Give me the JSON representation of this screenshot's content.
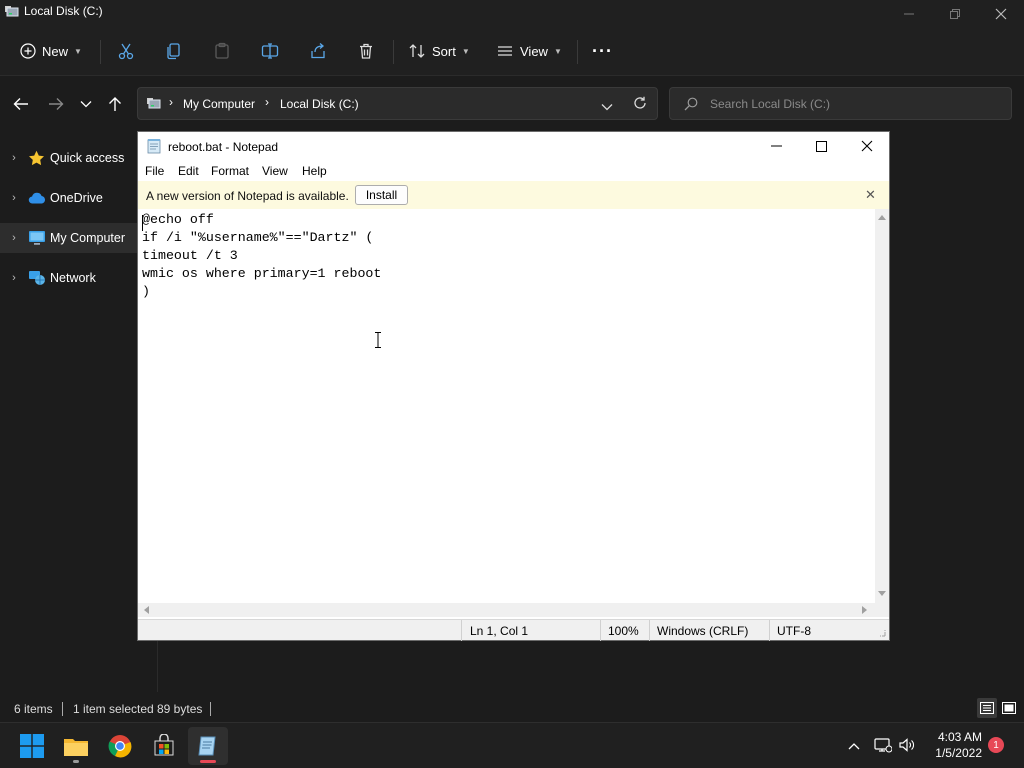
{
  "explorer": {
    "title": "Local Disk (C:)",
    "toolbar": {
      "new_label": "New",
      "sort_label": "Sort",
      "view_label": "View",
      "more_label": "···"
    },
    "breadcrumb": [
      "My Computer",
      "Local Disk (C:)"
    ],
    "search": {
      "placeholder": "Search Local Disk (C:)"
    },
    "sidebar": {
      "items": [
        {
          "label": "Quick access",
          "icon": "star-icon"
        },
        {
          "label": "OneDrive",
          "icon": "cloud-icon"
        },
        {
          "label": "My Computer",
          "icon": "computer-icon",
          "selected": true
        },
        {
          "label": "Network",
          "icon": "network-icon"
        }
      ]
    },
    "status": {
      "items_count": "6 items",
      "selection": "1 item selected",
      "size": "89 bytes"
    }
  },
  "notepad": {
    "title": "reboot.bat - Notepad",
    "menu": [
      "File",
      "Edit",
      "Format",
      "View",
      "Help"
    ],
    "info_bar": {
      "message": "A new version of Notepad is available.",
      "button": "Install"
    },
    "content_lines": [
      "@echo off",
      "if /i \"%username%\"==\"Dartz\" (",
      "timeout /t 3",
      "wmic os where primary=1 reboot",
      ")"
    ],
    "status": {
      "position": "Ln 1, Col 1",
      "zoom": "100%",
      "line_ending": "Windows (CRLF)",
      "encoding": "UTF-8"
    }
  },
  "taskbar": {
    "apps": [
      "windows-start-icon",
      "file-explorer-icon",
      "chrome-icon",
      "store-icon",
      "notepad-icon"
    ],
    "clock": {
      "time": "4:03 AM",
      "date": "1/5/2022"
    },
    "notification_count": "1"
  },
  "colors": {
    "accent": "#0078d4",
    "explorer_bg": "#1c1c1c",
    "info_bar_bg": "#fdfadf",
    "notification_badge": "#e74856"
  }
}
